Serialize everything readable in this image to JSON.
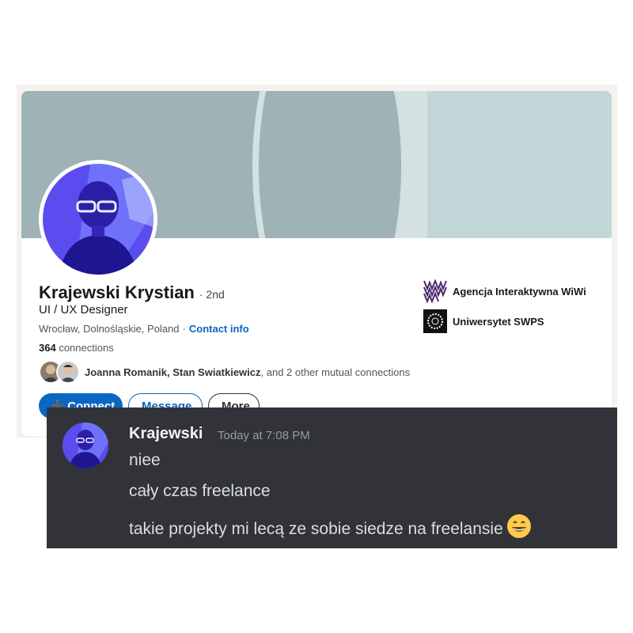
{
  "profile": {
    "name": "Krajewski Krystian",
    "degree": "· 2nd",
    "headline": "UI / UX Designer",
    "location": "Wrocław, Dolnośląskie, Poland",
    "location_sep": "·",
    "contact_info": "Contact info",
    "connections_count": "364",
    "connections_label": "connections",
    "mutual_names": "Joanna Romanik, Stan Swiatkiewicz",
    "mutual_rest": ", and 2 other mutual connections",
    "buttons": {
      "connect": "Connect",
      "message": "Message",
      "more": "More"
    },
    "orgs": [
      {
        "name": "Agencja Interaktywna WiWi",
        "icon": "wiwi-logo"
      },
      {
        "name": "Uniwersytet SWPS",
        "icon": "swps-logo"
      }
    ],
    "colors": {
      "accent": "#0a66c2",
      "banner": "#9fb2b5"
    }
  },
  "chat": {
    "username": "Krajewski",
    "timestamp": "Today at 7:08 PM",
    "messages": [
      "niee",
      "cały czas freelance",
      "takie projekty mi lecą ze sobie siedze na freelansie"
    ],
    "emoji": "grinning-face-emoji",
    "colors": {
      "background": "#313338",
      "text": "#dbdee1"
    }
  }
}
